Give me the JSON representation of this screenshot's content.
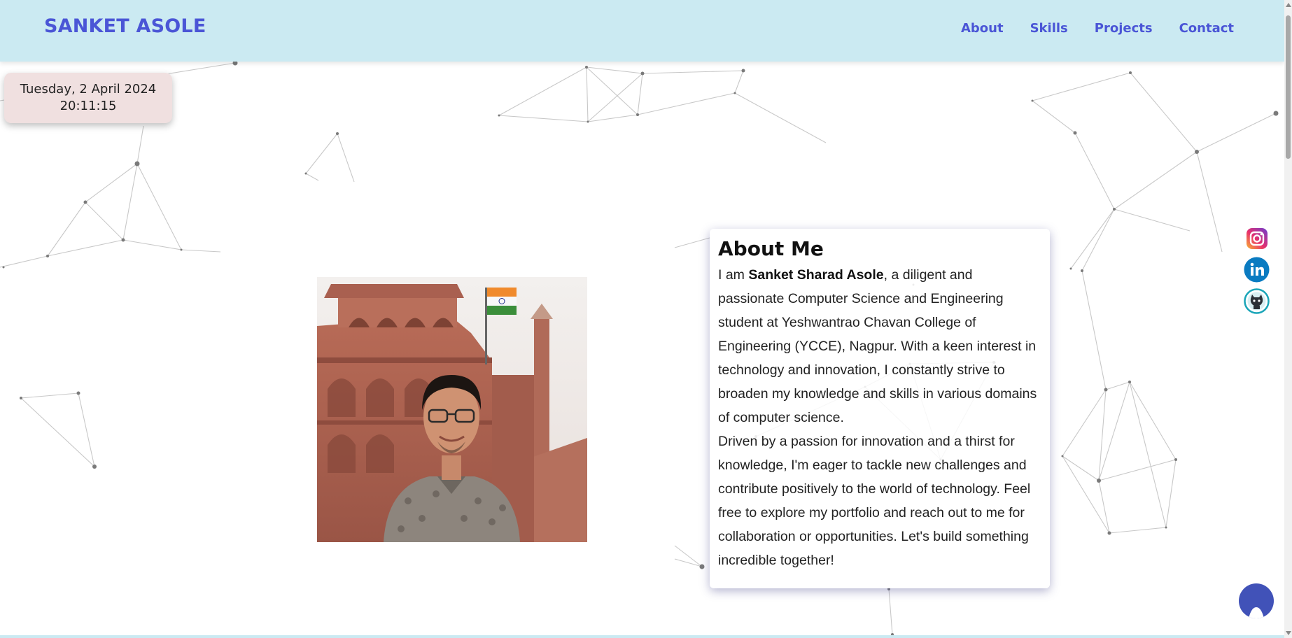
{
  "header": {
    "brand": "SANKET ASOLE",
    "nav": [
      "About",
      "Skills",
      "Projects",
      "Contact"
    ]
  },
  "datetime": {
    "date": "Tuesday, 2 April 2024",
    "time": "20:11:15"
  },
  "about": {
    "title": "About Me",
    "intro_prefix": "I am ",
    "name": "Sanket Sharad Asole",
    "intro_rest": ", a diligent and passionate Computer Science and Engineering student at Yeshwantrao Chavan College of Engineering (YCCE), Nagpur. With a keen interest in technology and innovation, I constantly strive to broaden my knowledge and skills in various domains of computer science.",
    "paragraph2": "Driven by a passion for innovation and a thirst for knowledge, I'm eager to tackle new challenges and contribute positively to the world of technology. Feel free to explore my portfolio and reach out to me for collaboration or opportunities. Let's build something incredible together!"
  },
  "social": [
    "instagram-icon",
    "linkedin-icon",
    "github-icon"
  ],
  "colors": {
    "header_bg": "#cbeaf2",
    "accent": "#4a55d6",
    "card_bg": "#ffffff",
    "datetime_bg": "#f0e0e0",
    "chat_bg": "#4152b8"
  }
}
